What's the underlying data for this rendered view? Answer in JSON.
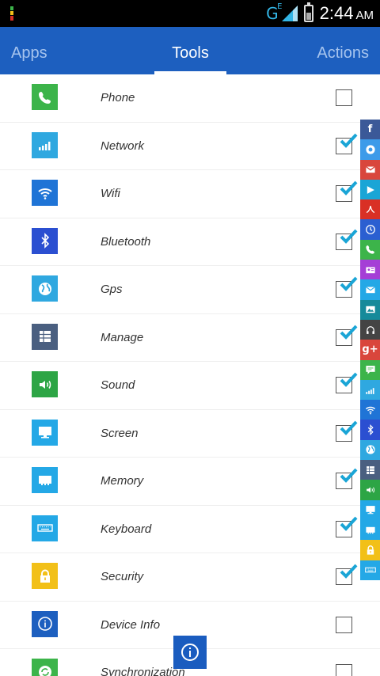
{
  "status_bar": {
    "network_type": "G",
    "network_sup": "E",
    "time": "2:44",
    "ampm": "AM"
  },
  "tabs": [
    {
      "label": "Apps",
      "active": false
    },
    {
      "label": "Tools",
      "active": true
    },
    {
      "label": "Actions",
      "active": false
    }
  ],
  "list": [
    {
      "label": "Phone",
      "icon": "phone-icon",
      "color": "#3cb44a",
      "checked": false
    },
    {
      "label": "Network",
      "icon": "signal-icon",
      "color": "#2fa8e0",
      "checked": true
    },
    {
      "label": "Wifi",
      "icon": "wifi-icon",
      "color": "#1f74d6",
      "checked": true
    },
    {
      "label": "Bluetooth",
      "icon": "bluetooth-icon",
      "color": "#2b4fd1",
      "checked": true
    },
    {
      "label": "Gps",
      "icon": "globe-icon",
      "color": "#2fa8e0",
      "checked": true
    },
    {
      "label": "Manage",
      "icon": "grid-icon",
      "color": "#4a5f80",
      "checked": true
    },
    {
      "label": "Sound",
      "icon": "speaker-icon",
      "color": "#2da545",
      "checked": true
    },
    {
      "label": "Screen",
      "icon": "monitor-icon",
      "color": "#24a8e6",
      "checked": true
    },
    {
      "label": "Memory",
      "icon": "memory-icon",
      "color": "#24a8e6",
      "checked": true
    },
    {
      "label": "Keyboard",
      "icon": "keyboard-icon",
      "color": "#24a8e6",
      "checked": true
    },
    {
      "label": "Security",
      "icon": "lock-icon",
      "color": "#f2c018",
      "checked": true
    },
    {
      "label": "Device Info",
      "icon": "info-icon",
      "color": "#1d5fbf",
      "checked": false
    },
    {
      "label": "Synchronization",
      "icon": "sync-icon",
      "color": "#3cb44a",
      "checked": false
    }
  ],
  "quickbar": [
    {
      "icon": "facebook-icon",
      "color": "#3b5998",
      "glyph": "f"
    },
    {
      "icon": "chrome-icon",
      "color": "#3d9be9",
      "glyph": ""
    },
    {
      "icon": "gmail-icon",
      "color": "#d9463c",
      "glyph": ""
    },
    {
      "icon": "play-store-icon",
      "color": "#1aa5d6",
      "glyph": ""
    },
    {
      "icon": "pdf-icon",
      "color": "#d93025",
      "glyph": ""
    },
    {
      "icon": "clock-icon",
      "color": "#2b5fd1",
      "glyph": ""
    },
    {
      "icon": "phone-icon",
      "color": "#3cb44a",
      "glyph": ""
    },
    {
      "icon": "contacts-icon",
      "color": "#a53fd6",
      "glyph": ""
    },
    {
      "icon": "email-icon",
      "color": "#24a8e6",
      "glyph": ""
    },
    {
      "icon": "gallery-icon",
      "color": "#168a9a",
      "glyph": ""
    },
    {
      "icon": "headphones-icon",
      "color": "#444444",
      "glyph": ""
    },
    {
      "icon": "google-plus-icon",
      "color": "#d9463c",
      "glyph": "g+"
    },
    {
      "icon": "message-icon",
      "color": "#3cb44a",
      "glyph": ""
    },
    {
      "icon": "signal-icon",
      "color": "#2fa8e0",
      "glyph": ""
    },
    {
      "icon": "wifi-icon",
      "color": "#1f74d6",
      "glyph": ""
    },
    {
      "icon": "bluetooth-icon",
      "color": "#2b4fd1",
      "glyph": ""
    },
    {
      "icon": "globe-icon",
      "color": "#2fa8e0",
      "glyph": ""
    },
    {
      "icon": "grid-icon",
      "color": "#4a5f80",
      "glyph": ""
    },
    {
      "icon": "speaker-icon",
      "color": "#2da545",
      "glyph": ""
    },
    {
      "icon": "monitor-icon",
      "color": "#24a8e6",
      "glyph": ""
    },
    {
      "icon": "memory-icon",
      "color": "#24a8e6",
      "glyph": ""
    },
    {
      "icon": "lock-icon",
      "color": "#f2c018",
      "glyph": ""
    },
    {
      "icon": "keyboard-icon",
      "color": "#24a8e6",
      "glyph": ""
    }
  ],
  "fab": {
    "icon": "info-icon",
    "color": "#1a5cbf"
  },
  "colors": {
    "tab_bar": "#1d5fbf",
    "checkmark": "#1aa5d6"
  }
}
